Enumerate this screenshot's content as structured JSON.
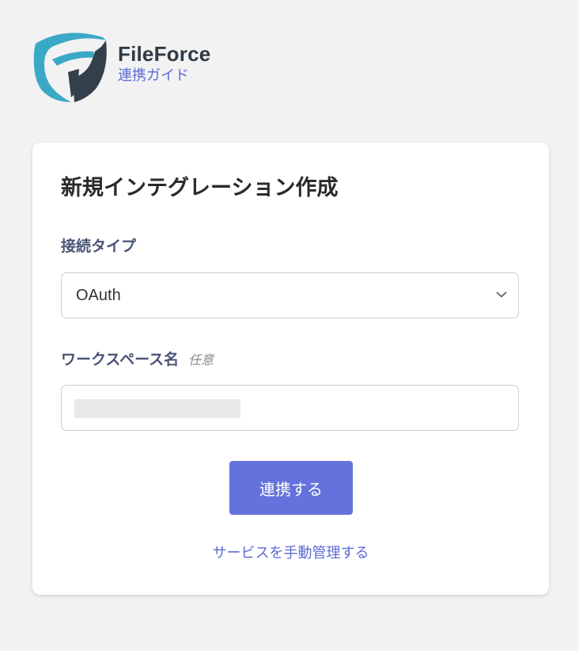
{
  "brand": {
    "name": "FileForce",
    "guide_link": "連携ガイド",
    "logo_icon": "fileforce-shield-logo",
    "colors": {
      "logo_teal": "#3aa9c6",
      "logo_dark": "#33404b",
      "accent": "#5b6bd6"
    }
  },
  "form": {
    "title": "新規インテグレーション作成",
    "connection_type": {
      "label": "接続タイプ",
      "selected": "OAuth",
      "icon": "chevron-down-icon"
    },
    "workspace": {
      "label": "ワークスペース名",
      "optional_tag": "任意",
      "value": ""
    },
    "submit_label": "連携する",
    "manual_link": "サービスを手動管理する"
  },
  "colors": {
    "background": "#f2f2f2",
    "card": "#ffffff",
    "button": "#6472dc",
    "label": "#4a5375"
  }
}
